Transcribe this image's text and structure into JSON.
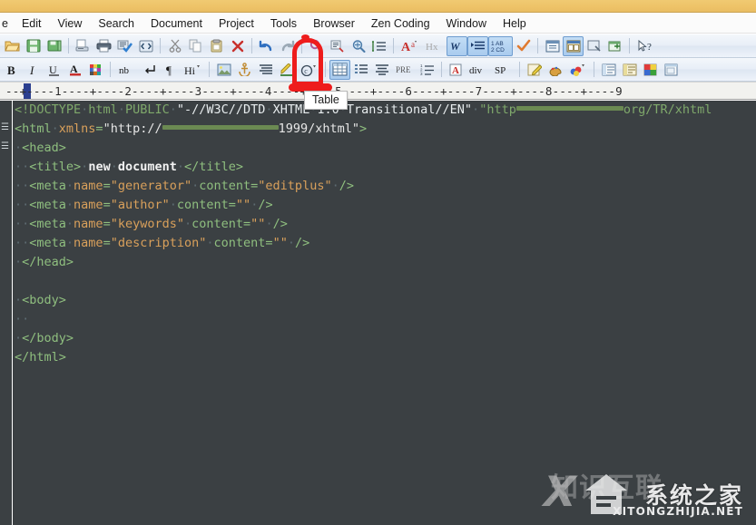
{
  "window": {
    "titlebar_color": "#eec368",
    "app": "EditPlus"
  },
  "menubar": {
    "items": [
      {
        "label": "e",
        "name": "menu-file-clipped"
      },
      {
        "label": "Edit",
        "name": "menu-edit"
      },
      {
        "label": "View",
        "name": "menu-view"
      },
      {
        "label": "Search",
        "name": "menu-search"
      },
      {
        "label": "Document",
        "name": "menu-document"
      },
      {
        "label": "Project",
        "name": "menu-project"
      },
      {
        "label": "Tools",
        "name": "menu-tools"
      },
      {
        "label": "Browser",
        "name": "menu-browser"
      },
      {
        "label": "Zen Coding",
        "name": "menu-zen-coding"
      },
      {
        "label": "Window",
        "name": "menu-window"
      },
      {
        "label": "Help",
        "name": "menu-help"
      }
    ]
  },
  "toolbar_main": {
    "buttons": [
      {
        "icon": "open-folder-icon",
        "label": "Open"
      },
      {
        "icon": "save-icon",
        "label": "Save"
      },
      {
        "icon": "save-all-icon",
        "label": "Save All"
      },
      {
        "icon": "print-preview-icon",
        "label": "Print Preview"
      },
      {
        "icon": "print-icon",
        "label": "Print"
      },
      {
        "icon": "spellcheck-icon",
        "label": "Spell Check"
      },
      {
        "icon": "code-brackets-icon",
        "label": "Edit Source"
      },
      {
        "icon": "cut-icon",
        "label": "Cut"
      },
      {
        "icon": "copy-icon",
        "label": "Copy"
      },
      {
        "icon": "paste-icon",
        "label": "Paste"
      },
      {
        "icon": "delete-x-icon",
        "label": "Delete"
      },
      {
        "icon": "undo-icon",
        "label": "Undo"
      },
      {
        "icon": "redo-icon",
        "label": "Redo"
      },
      {
        "icon": "find-icon",
        "label": "Find"
      },
      {
        "icon": "replace-icon",
        "label": "Replace"
      },
      {
        "icon": "find-in-files-icon",
        "label": "Find in Files"
      },
      {
        "icon": "goto-line-icon",
        "label": "Go to Line"
      },
      {
        "icon": "font-size-icon",
        "label": "Font"
      },
      {
        "icon": "hex-viewer-icon",
        "label": "Hex Viewer"
      },
      {
        "icon": "word-wrap-icon",
        "label": "Word Wrap"
      },
      {
        "icon": "indent-icon",
        "label": "Auto Indent"
      },
      {
        "icon": "abcd-icon",
        "label": "Check Spelling"
      },
      {
        "icon": "check-orange-icon",
        "label": "Validate"
      },
      {
        "icon": "browser-preview-icon",
        "label": "Preview"
      },
      {
        "icon": "browser-window-icon",
        "label": "Browser"
      },
      {
        "icon": "user-tool-icon",
        "label": "User Tool"
      },
      {
        "icon": "new-window-icon",
        "label": "New Window"
      },
      {
        "icon": "help-pointer-icon",
        "label": "Context Help"
      }
    ]
  },
  "toolbar_html": {
    "buttons": [
      {
        "icon": "bold-icon",
        "label": "B"
      },
      {
        "icon": "italic-icon",
        "label": "I"
      },
      {
        "icon": "underline-icon",
        "label": "U"
      },
      {
        "icon": "font-color-icon",
        "label": "A"
      },
      {
        "icon": "color-palette-icon",
        "label": "Colors"
      },
      {
        "icon": "nbsp-icon",
        "label": "nb"
      },
      {
        "icon": "line-break-icon",
        "label": "Line Break"
      },
      {
        "icon": "paragraph-icon",
        "label": "Paragraph"
      },
      {
        "icon": "heading-icon",
        "label": "Hi"
      },
      {
        "icon": "image-icon",
        "label": "Image"
      },
      {
        "icon": "anchor-icon",
        "label": "Anchor"
      },
      {
        "icon": "align-icon",
        "label": "Align"
      },
      {
        "icon": "highlight-pen-icon",
        "label": "Highlight"
      },
      {
        "icon": "copyright-icon",
        "label": "Special Char"
      },
      {
        "icon": "table-icon",
        "label": "Table"
      },
      {
        "icon": "list-icon",
        "label": "List"
      },
      {
        "icon": "align-center-icon",
        "label": "Align Center"
      },
      {
        "icon": "pre-icon",
        "label": "PRE"
      },
      {
        "icon": "ordered-list-icon",
        "label": "Ordered List"
      },
      {
        "icon": "anchor-name-icon",
        "label": "A"
      },
      {
        "icon": "div-icon",
        "label": "div"
      },
      {
        "icon": "span-icon",
        "label": "SP"
      },
      {
        "icon": "note-edit-icon",
        "label": "Edit Note"
      },
      {
        "icon": "palette-brush-icon",
        "label": "Brush"
      },
      {
        "icon": "color-mix-icon",
        "label": "Color Mix"
      },
      {
        "icon": "form-list-icon",
        "label": "Form"
      },
      {
        "icon": "form-fields-icon",
        "label": "Form Fields"
      },
      {
        "icon": "color-picker-icon",
        "label": "Color Picker"
      },
      {
        "icon": "frame-icon",
        "label": "Frame"
      }
    ]
  },
  "ruler": {
    "text": "--+----1----+----2----+----3----+----4----+----5----+----6----+----7----+----8----+----9",
    "caret_column": 1
  },
  "tooltip": {
    "text": "Table",
    "visible": true
  },
  "annotation": {
    "color": "#ee1c1c",
    "shape": "rounded-rectangle-highlight",
    "targets": "table-icon"
  },
  "editor": {
    "background": "#3b4043",
    "lines": [
      {
        "segs": [
          {
            "t": "doc",
            "v": "<!DOCTYPE"
          },
          {
            "t": "dot",
            "v": "·"
          },
          {
            "t": "doc",
            "v": "html"
          },
          {
            "t": "dot",
            "v": "·"
          },
          {
            "t": "doc",
            "v": "PUBLIC"
          },
          {
            "t": "dot",
            "v": "·"
          },
          {
            "t": "white",
            "v": "\"-//W3C//DTD"
          },
          {
            "t": "dot",
            "v": "·"
          },
          {
            "t": "white",
            "v": "XHTML"
          },
          {
            "t": "dot",
            "v": "·"
          },
          {
            "t": "white",
            "v": "1.0"
          },
          {
            "t": "dot",
            "v": "·"
          },
          {
            "t": "white",
            "v": "Transitional//EN\""
          },
          {
            "t": "dot",
            "v": "·"
          },
          {
            "t": "doc",
            "v": "\"http"
          },
          {
            "t": "redact1",
            "v": ""
          },
          {
            "t": "doc",
            "v": "org/TR/xhtml"
          }
        ]
      },
      {
        "segs": [
          {
            "t": "tag",
            "v": "<html"
          },
          {
            "t": "dot",
            "v": "·"
          },
          {
            "t": "attr",
            "v": "xmlns"
          },
          {
            "t": "tag",
            "v": "="
          },
          {
            "t": "val",
            "v": "\"http://"
          },
          {
            "t": "redact2",
            "v": ""
          },
          {
            "t": "val",
            "v": "1999/xhtml\""
          },
          {
            "t": "tag",
            "v": ">"
          }
        ]
      },
      {
        "segs": [
          {
            "t": "dot",
            "v": "·"
          },
          {
            "t": "tag",
            "v": "<head>"
          }
        ]
      },
      {
        "segs": [
          {
            "t": "dot",
            "v": "··"
          },
          {
            "t": "tag",
            "v": "<title>"
          },
          {
            "t": "dot",
            "v": "·"
          },
          {
            "t": "text",
            "v": "new"
          },
          {
            "t": "dot",
            "v": "·"
          },
          {
            "t": "text",
            "v": "document"
          },
          {
            "t": "dot",
            "v": "·"
          },
          {
            "t": "tag",
            "v": "</title>"
          }
        ]
      },
      {
        "segs": [
          {
            "t": "dot",
            "v": "··"
          },
          {
            "t": "tag",
            "v": "<meta"
          },
          {
            "t": "dot",
            "v": "·"
          },
          {
            "t": "attr",
            "v": "name"
          },
          {
            "t": "tag",
            "v": "="
          },
          {
            "t": "attr",
            "v": "\"generator\""
          },
          {
            "t": "dot",
            "v": "·"
          },
          {
            "t": "tag",
            "v": "content"
          },
          {
            "t": "tag",
            "v": "="
          },
          {
            "t": "attr",
            "v": "\"editplus\""
          },
          {
            "t": "dot",
            "v": "·"
          },
          {
            "t": "tag",
            "v": "/>"
          }
        ]
      },
      {
        "segs": [
          {
            "t": "dot",
            "v": "··"
          },
          {
            "t": "tag",
            "v": "<meta"
          },
          {
            "t": "dot",
            "v": "·"
          },
          {
            "t": "attr",
            "v": "name"
          },
          {
            "t": "tag",
            "v": "="
          },
          {
            "t": "attr",
            "v": "\"author\""
          },
          {
            "t": "dot",
            "v": "·"
          },
          {
            "t": "tag",
            "v": "content"
          },
          {
            "t": "tag",
            "v": "="
          },
          {
            "t": "attr",
            "v": "\"\""
          },
          {
            "t": "dot",
            "v": "·"
          },
          {
            "t": "tag",
            "v": "/>"
          }
        ]
      },
      {
        "segs": [
          {
            "t": "dot",
            "v": "··"
          },
          {
            "t": "tag",
            "v": "<meta"
          },
          {
            "t": "dot",
            "v": "·"
          },
          {
            "t": "attr",
            "v": "name"
          },
          {
            "t": "tag",
            "v": "="
          },
          {
            "t": "attr",
            "v": "\"keywords\""
          },
          {
            "t": "dot",
            "v": "·"
          },
          {
            "t": "tag",
            "v": "content"
          },
          {
            "t": "tag",
            "v": "="
          },
          {
            "t": "attr",
            "v": "\"\""
          },
          {
            "t": "dot",
            "v": "·"
          },
          {
            "t": "tag",
            "v": "/>"
          }
        ]
      },
      {
        "segs": [
          {
            "t": "dot",
            "v": "··"
          },
          {
            "t": "tag",
            "v": "<meta"
          },
          {
            "t": "dot",
            "v": "·"
          },
          {
            "t": "attr",
            "v": "name"
          },
          {
            "t": "tag",
            "v": "="
          },
          {
            "t": "attr",
            "v": "\"description\""
          },
          {
            "t": "dot",
            "v": "·"
          },
          {
            "t": "tag",
            "v": "content"
          },
          {
            "t": "tag",
            "v": "="
          },
          {
            "t": "attr",
            "v": "\"\""
          },
          {
            "t": "dot",
            "v": "·"
          },
          {
            "t": "tag",
            "v": "/>"
          }
        ]
      },
      {
        "segs": [
          {
            "t": "dot",
            "v": "·"
          },
          {
            "t": "tag",
            "v": "</head>"
          }
        ]
      },
      {
        "segs": []
      },
      {
        "segs": [
          {
            "t": "dot",
            "v": "·"
          },
          {
            "t": "tag",
            "v": "<body>"
          }
        ]
      },
      {
        "segs": [
          {
            "t": "dot",
            "v": "··"
          }
        ]
      },
      {
        "segs": [
          {
            "t": "dot",
            "v": "·"
          },
          {
            "t": "tag",
            "v": "</body>"
          }
        ]
      },
      {
        "segs": [
          {
            "t": "tag",
            "v": "</html>"
          }
        ]
      }
    ],
    "fold_markers": [
      1,
      2
    ]
  },
  "watermark": {
    "cn": "系统之家",
    "en": "XITONGZHIJIA.NET",
    "ghost": "知识互联"
  }
}
